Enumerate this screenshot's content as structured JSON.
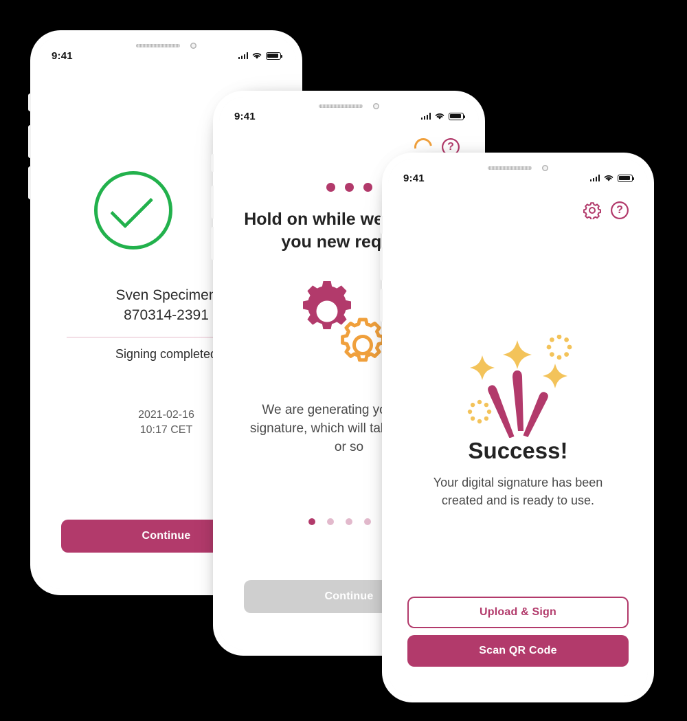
{
  "meta": {
    "background_color": "#000000",
    "brand_magenta": "#B23A6B",
    "accent_orange": "#F0A03C",
    "success_green": "#22B14C"
  },
  "status_bar": {
    "time": "9:41",
    "signal_icon": "signal-bars-icon",
    "wifi_icon": "wifi-icon",
    "battery_icon": "battery-icon"
  },
  "phone1": {
    "name": "signing-complete-screen",
    "check_icon": "checkmark-circle-icon",
    "person_name": "Sven Specimen",
    "person_id": "870314-2391",
    "status_text": "Signing completed",
    "timestamp_date": "2021-02-16",
    "timestamp_time": "10:17 CET",
    "continue_label": "Continue"
  },
  "phone2": {
    "name": "generating-signature-screen",
    "spinner_icon": "loading-spinner-icon",
    "help_icon": "help-circle-icon",
    "dots_icon": "three-dots-icon",
    "title": "Hold on while we process you new request",
    "gears_icon": "gears-illustration",
    "body": "We are generating your digital signature, which will take a minute or so",
    "pager": {
      "count": 5,
      "active_index": 0
    },
    "continue_label": "Continue",
    "continue_disabled": true
  },
  "phone3": {
    "name": "success-screen",
    "settings_icon": "gear-icon",
    "help_icon": "help-circle-icon",
    "fireworks_icon": "fireworks-illustration",
    "title": "Success!",
    "body": "Your digital signature has been created and is ready to use.",
    "primary_label": "Scan QR Code",
    "secondary_label": "Upload & Sign"
  }
}
